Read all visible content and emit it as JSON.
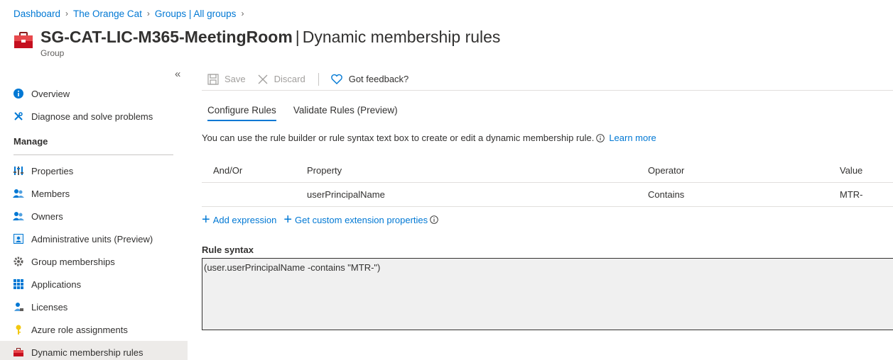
{
  "breadcrumb": [
    "Dashboard",
    "The Orange Cat",
    "Groups | All groups"
  ],
  "header": {
    "name": "SG-CAT-LIC-M365-MeetingRoom",
    "section": "Dynamic membership rules",
    "subtitle": "Group"
  },
  "nav": {
    "overview": "Overview",
    "diagnose": "Diagnose and solve problems",
    "manage_heading": "Manage",
    "properties": "Properties",
    "members": "Members",
    "owners": "Owners",
    "admin_units": "Administrative units (Preview)",
    "group_memberships": "Group memberships",
    "applications": "Applications",
    "licenses": "Licenses",
    "azure_roles": "Azure role assignments",
    "dynamic_rules": "Dynamic membership rules"
  },
  "toolbar": {
    "save": "Save",
    "discard": "Discard",
    "feedback": "Got feedback?"
  },
  "tabs": {
    "configure": "Configure Rules",
    "validate": "Validate Rules (Preview)"
  },
  "info": {
    "text": "You can use the rule builder or rule syntax text box to create or edit a dynamic membership rule.",
    "learn_more": "Learn more"
  },
  "rules_table": {
    "headers": {
      "andor": "And/Or",
      "property": "Property",
      "operator": "Operator",
      "value": "Value"
    },
    "rows": [
      {
        "andor": "",
        "property": "userPrincipalName",
        "operator": "Contains",
        "value": "MTR-"
      }
    ]
  },
  "actions": {
    "add_expression": "Add expression",
    "custom_ext": "Get custom extension properties"
  },
  "syntax": {
    "label": "Rule syntax",
    "value": "(user.userPrincipalName -contains \"MTR-\")"
  },
  "colors": {
    "accent": "#0078d4",
    "toolbox_red": "#c50f1f"
  }
}
